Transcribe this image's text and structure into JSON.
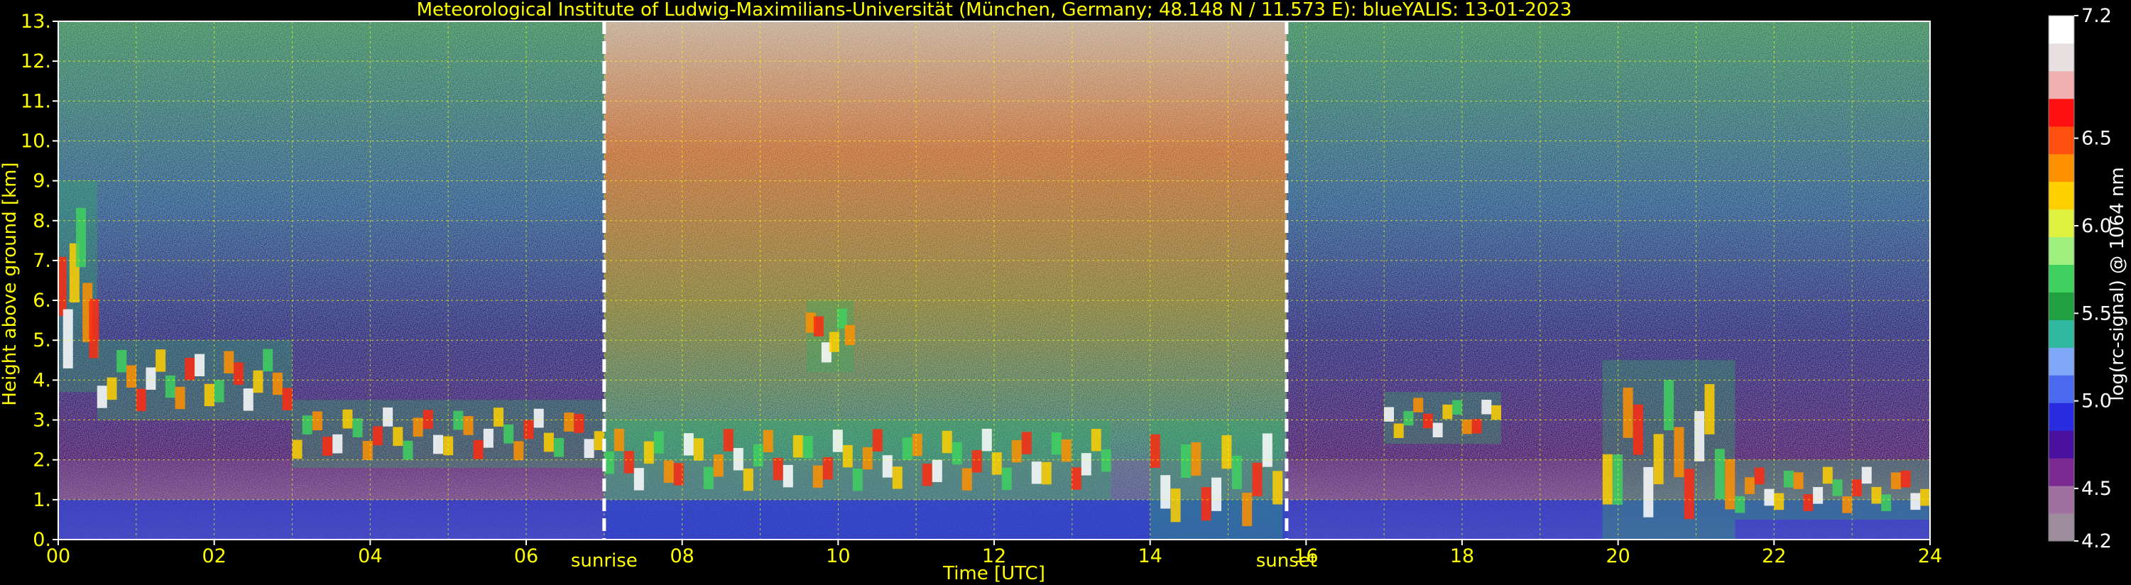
{
  "chart_data": {
    "type": "heatmap",
    "title": "Meteorological Institute of Ludwig-Maximilians-Universität (München, Germany; 48.148 N / 11.573 E):    blueYALIS: 13-01-2023",
    "xlabel": "Time [UTC]",
    "ylabel": "Height above ground [km]",
    "xlim": [
      0,
      24
    ],
    "ylim": [
      0,
      13
    ],
    "x_tick_labels": [
      "00",
      "02",
      "04",
      "06",
      "08",
      "10",
      "12",
      "14",
      "16",
      "18",
      "20",
      "22",
      "24"
    ],
    "y_tick_labels": [
      "0.",
      "1.",
      "2.",
      "3.",
      "4.",
      "5.",
      "6.",
      "7.",
      "8.",
      "9.",
      "10.",
      "11.",
      "12.",
      "13."
    ],
    "grid": true,
    "grid_color": "#ffff00",
    "text_color": "#ffff00",
    "annotations": [
      {
        "label": "sunrise",
        "time": 7.0
      },
      {
        "label": "sunset",
        "time": 15.75
      }
    ],
    "colorbar": {
      "label": "log(rc-signal) @ 1064 nm",
      "range": [
        4.2,
        7.2
      ],
      "tick_labels": [
        "4.2",
        "4.5",
        "5.0",
        "5.5",
        "6.0",
        "6.5",
        "7.2"
      ],
      "tick_values": [
        4.2,
        4.5,
        5.0,
        5.5,
        6.0,
        6.5,
        7.2
      ],
      "colors": [
        "#9c8c9c",
        "#a070a0",
        "#7a2a90",
        "#4a10a0",
        "#2a2ae0",
        "#4a6af0",
        "#80a8f8",
        "#30b8a0",
        "#20a040",
        "#40d060",
        "#a0f080",
        "#e0f040",
        "#ffd000",
        "#ff9000",
        "#ff5010",
        "#ff1010",
        "#f0b0b0",
        "#e8e0e0",
        "#ffffff"
      ]
    },
    "cloud_layers": [
      {
        "t0": 0.0,
        "t1": 0.5,
        "h0": 3.7,
        "h1": 9.0
      },
      {
        "t0": 0.5,
        "t1": 3.0,
        "h0": 3.0,
        "h1": 5.0
      },
      {
        "t0": 3.0,
        "t1": 7.0,
        "h0": 1.8,
        "h1": 3.5
      },
      {
        "t0": 7.0,
        "t1": 13.5,
        "h0": 1.0,
        "h1": 3.0
      },
      {
        "t0": 9.6,
        "t1": 10.2,
        "h0": 4.2,
        "h1": 6.0
      },
      {
        "t0": 14.0,
        "t1": 15.7,
        "h0": 0.0,
        "h1": 3.0
      },
      {
        "t0": 17.0,
        "t1": 18.5,
        "h0": 2.4,
        "h1": 3.7
      },
      {
        "t0": 19.8,
        "t1": 21.5,
        "h0": 0.0,
        "h1": 4.5
      },
      {
        "t0": 21.5,
        "t1": 24.0,
        "h0": 0.5,
        "h1": 2.0
      }
    ]
  }
}
